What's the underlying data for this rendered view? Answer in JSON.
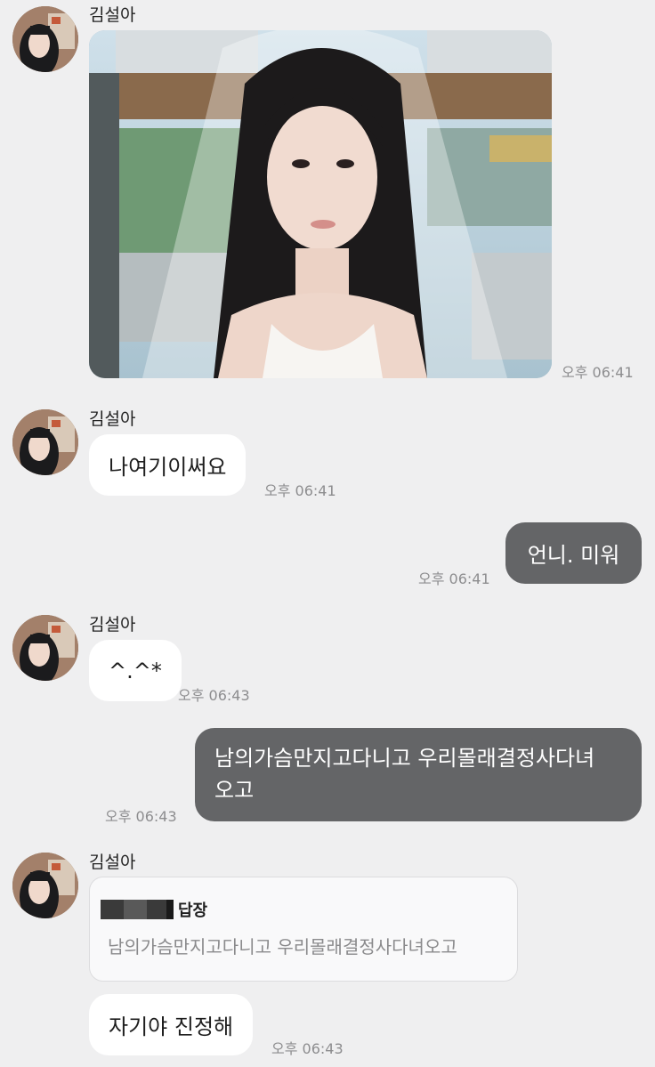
{
  "contact": {
    "name": "김설아"
  },
  "messages": [
    {
      "id": "m1",
      "sender": "김설아",
      "type": "image",
      "time": "오후 06:41"
    },
    {
      "id": "m2",
      "sender": "김설아",
      "type": "text",
      "text": "나여기이써요",
      "time": "오후 06:41"
    },
    {
      "id": "m3",
      "sender": "me",
      "type": "text",
      "text": "언니. 미워",
      "time": "오후 06:41"
    },
    {
      "id": "m4",
      "sender": "김설아",
      "type": "text",
      "text": "^.^*",
      "time": "오후 06:43"
    },
    {
      "id": "m5",
      "sender": "me",
      "type": "text",
      "text_line1": "남의가슴만지고다니고 우리몰래결정사다녀",
      "text_line2": "오고",
      "time": "오후 06:43"
    },
    {
      "id": "m6",
      "sender": "김설아",
      "type": "reply",
      "reply_label": "답장",
      "quoted_text": "남의가슴만지고다니고 우리몰래결정사다녀오고",
      "text": "자기야 진정해",
      "time": "오후 06:43"
    }
  ],
  "colors": {
    "background": "#efeff0",
    "incoming_bubble": "#ffffff",
    "outgoing_bubble": "#646567",
    "timestamp": "#8d8d8f"
  }
}
